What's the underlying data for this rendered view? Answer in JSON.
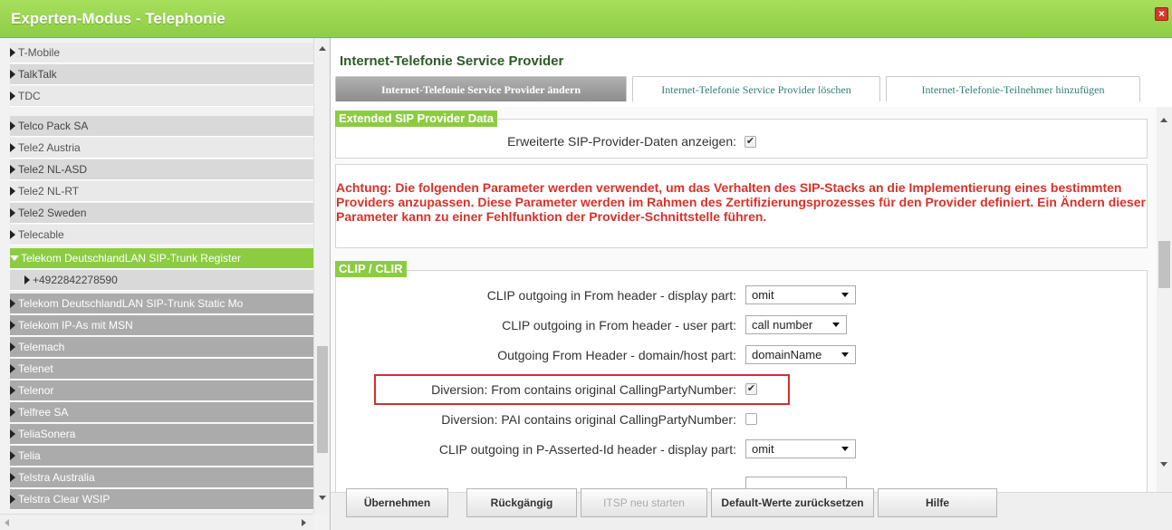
{
  "window": {
    "title": "Experten-Modus - Telephonie",
    "close_glyph": "×",
    "colors": {
      "accent": "#8ccc41",
      "warning": "#d8322a",
      "highlight": "#d23030"
    }
  },
  "sidebar": {
    "items": [
      {
        "label": "T-Mobile",
        "expanded": false
      },
      {
        "label": "TalkTalk",
        "expanded": false
      },
      {
        "label": "TDC",
        "expanded": false
      },
      {
        "label": "Telco Pack SA",
        "expanded": false
      },
      {
        "label": "Tele2 Austria",
        "expanded": false
      },
      {
        "label": "Tele2 NL-ASD",
        "expanded": false
      },
      {
        "label": "Tele2 NL-RT",
        "expanded": false
      },
      {
        "label": "Tele2 Sweden",
        "expanded": false
      },
      {
        "label": "Telecable",
        "expanded": false
      },
      {
        "label": "Telekom DeutschlandLAN SIP-Trunk Register",
        "expanded": true,
        "selected": true
      },
      {
        "label": "+4922842278590",
        "expanded": false,
        "child": true
      },
      {
        "label": "Telekom DeutschlandLAN SIP-Trunk Static Mo",
        "expanded": false
      },
      {
        "label": "Telekom IP-As mit MSN",
        "expanded": false
      },
      {
        "label": "Telemach",
        "expanded": false
      },
      {
        "label": "Telenet",
        "expanded": false
      },
      {
        "label": "Telenor",
        "expanded": false
      },
      {
        "label": "Telfree SA",
        "expanded": false
      },
      {
        "label": "TeliaSonera",
        "expanded": false
      },
      {
        "label": "Telia",
        "expanded": false
      },
      {
        "label": "Telstra Australia",
        "expanded": false
      },
      {
        "label": "Telstra Clear WSIP",
        "expanded": false
      }
    ]
  },
  "main": {
    "title": "Internet-Telefonie Service Provider",
    "tabs": [
      {
        "label": "Internet-Telefonie Service Provider ändern",
        "active": true
      },
      {
        "label": "Internet-Telefonie Service Provider löschen",
        "active": false
      },
      {
        "label": "Internet-Telefonie-Teilnehmer hinzufügen",
        "active": false
      }
    ],
    "extended": {
      "header": "Extended SIP Provider Data",
      "show_label": "Erweiterte SIP-Provider-Daten anzeigen:",
      "show_checked": true
    },
    "warning": "Achtung: Die folgenden Parameter werden verwendet, um das Verhalten des SIP-Stacks an die Implementierung eines bestimmten Providers anzupassen. Diese Parameter werden im Rahmen des Zertifizierungsprozesses für den Provider definiert. Ein Ändern dieser Parameter kann zu einer Fehlfunktion der Provider-Schnittstelle führen.",
    "clip": {
      "header": "CLIP / CLIR",
      "rows": [
        {
          "label": "CLIP outgoing in From header - display part:",
          "type": "select",
          "value": "omit"
        },
        {
          "label": "CLIP outgoing in From header - user part:",
          "type": "select",
          "value": "call number"
        },
        {
          "label": "Outgoing From Header - domain/host part:",
          "type": "select",
          "value": "domainName"
        },
        {
          "label": "Diversion: From contains original CallingPartyNumber:",
          "type": "checkbox",
          "checked": true,
          "highlighted": true
        },
        {
          "label": "Diversion: PAI contains original CallingPartyNumber:",
          "type": "checkbox",
          "checked": false
        },
        {
          "label": "CLIP outgoing in P-Asserted-Id header - display part:",
          "type": "select",
          "value": "omit"
        }
      ]
    },
    "buttons": [
      {
        "label": "Übernehmen",
        "enabled": true
      },
      {
        "label": "Rückgängig",
        "enabled": true
      },
      {
        "label": "ITSP neu starten",
        "enabled": false
      },
      {
        "label": "Default-Werte zurücksetzen",
        "enabled": true
      },
      {
        "label": "Hilfe",
        "enabled": true
      }
    ]
  }
}
